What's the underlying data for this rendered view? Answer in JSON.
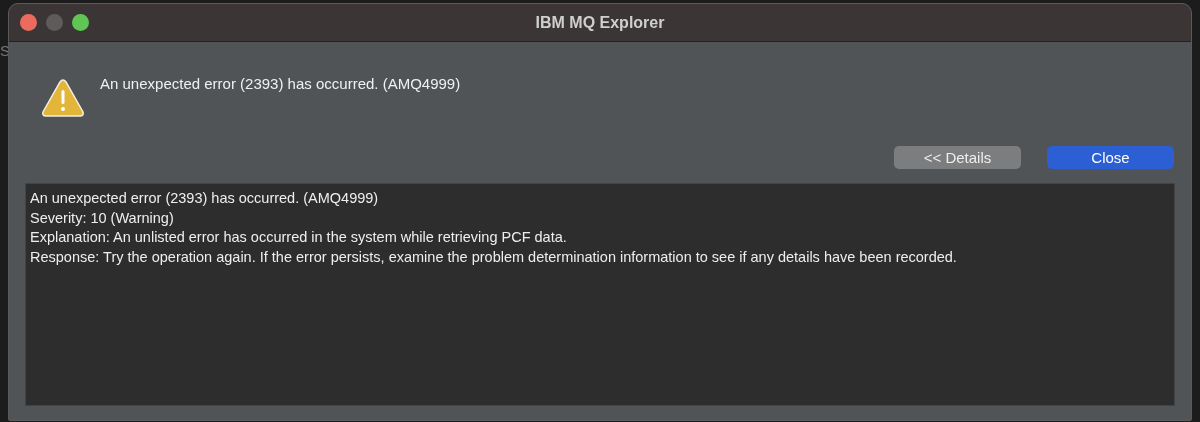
{
  "background": {
    "label": "S"
  },
  "window": {
    "title": "IBM MQ Explorer",
    "traffic_lights": [
      {
        "kind": "close",
        "disabled": false
      },
      {
        "kind": "minimize",
        "disabled": true
      },
      {
        "kind": "zoom",
        "disabled": false
      }
    ]
  },
  "message": "An unexpected error (2393) has occurred. (AMQ4999)",
  "buttons": [
    {
      "label": "<< Details",
      "kind": "secondary"
    },
    {
      "label": "Close",
      "kind": "default"
    }
  ],
  "details": [
    "An unexpected error (2393) has occurred. (AMQ4999)",
    "Severity: 10 (Warning)",
    "Explanation: An unlisted error has occurred in the system while retrieving PCF data.",
    "Response: Try the operation again. If the error persists, examine the problem determination information to see if any details have been recorded."
  ]
}
